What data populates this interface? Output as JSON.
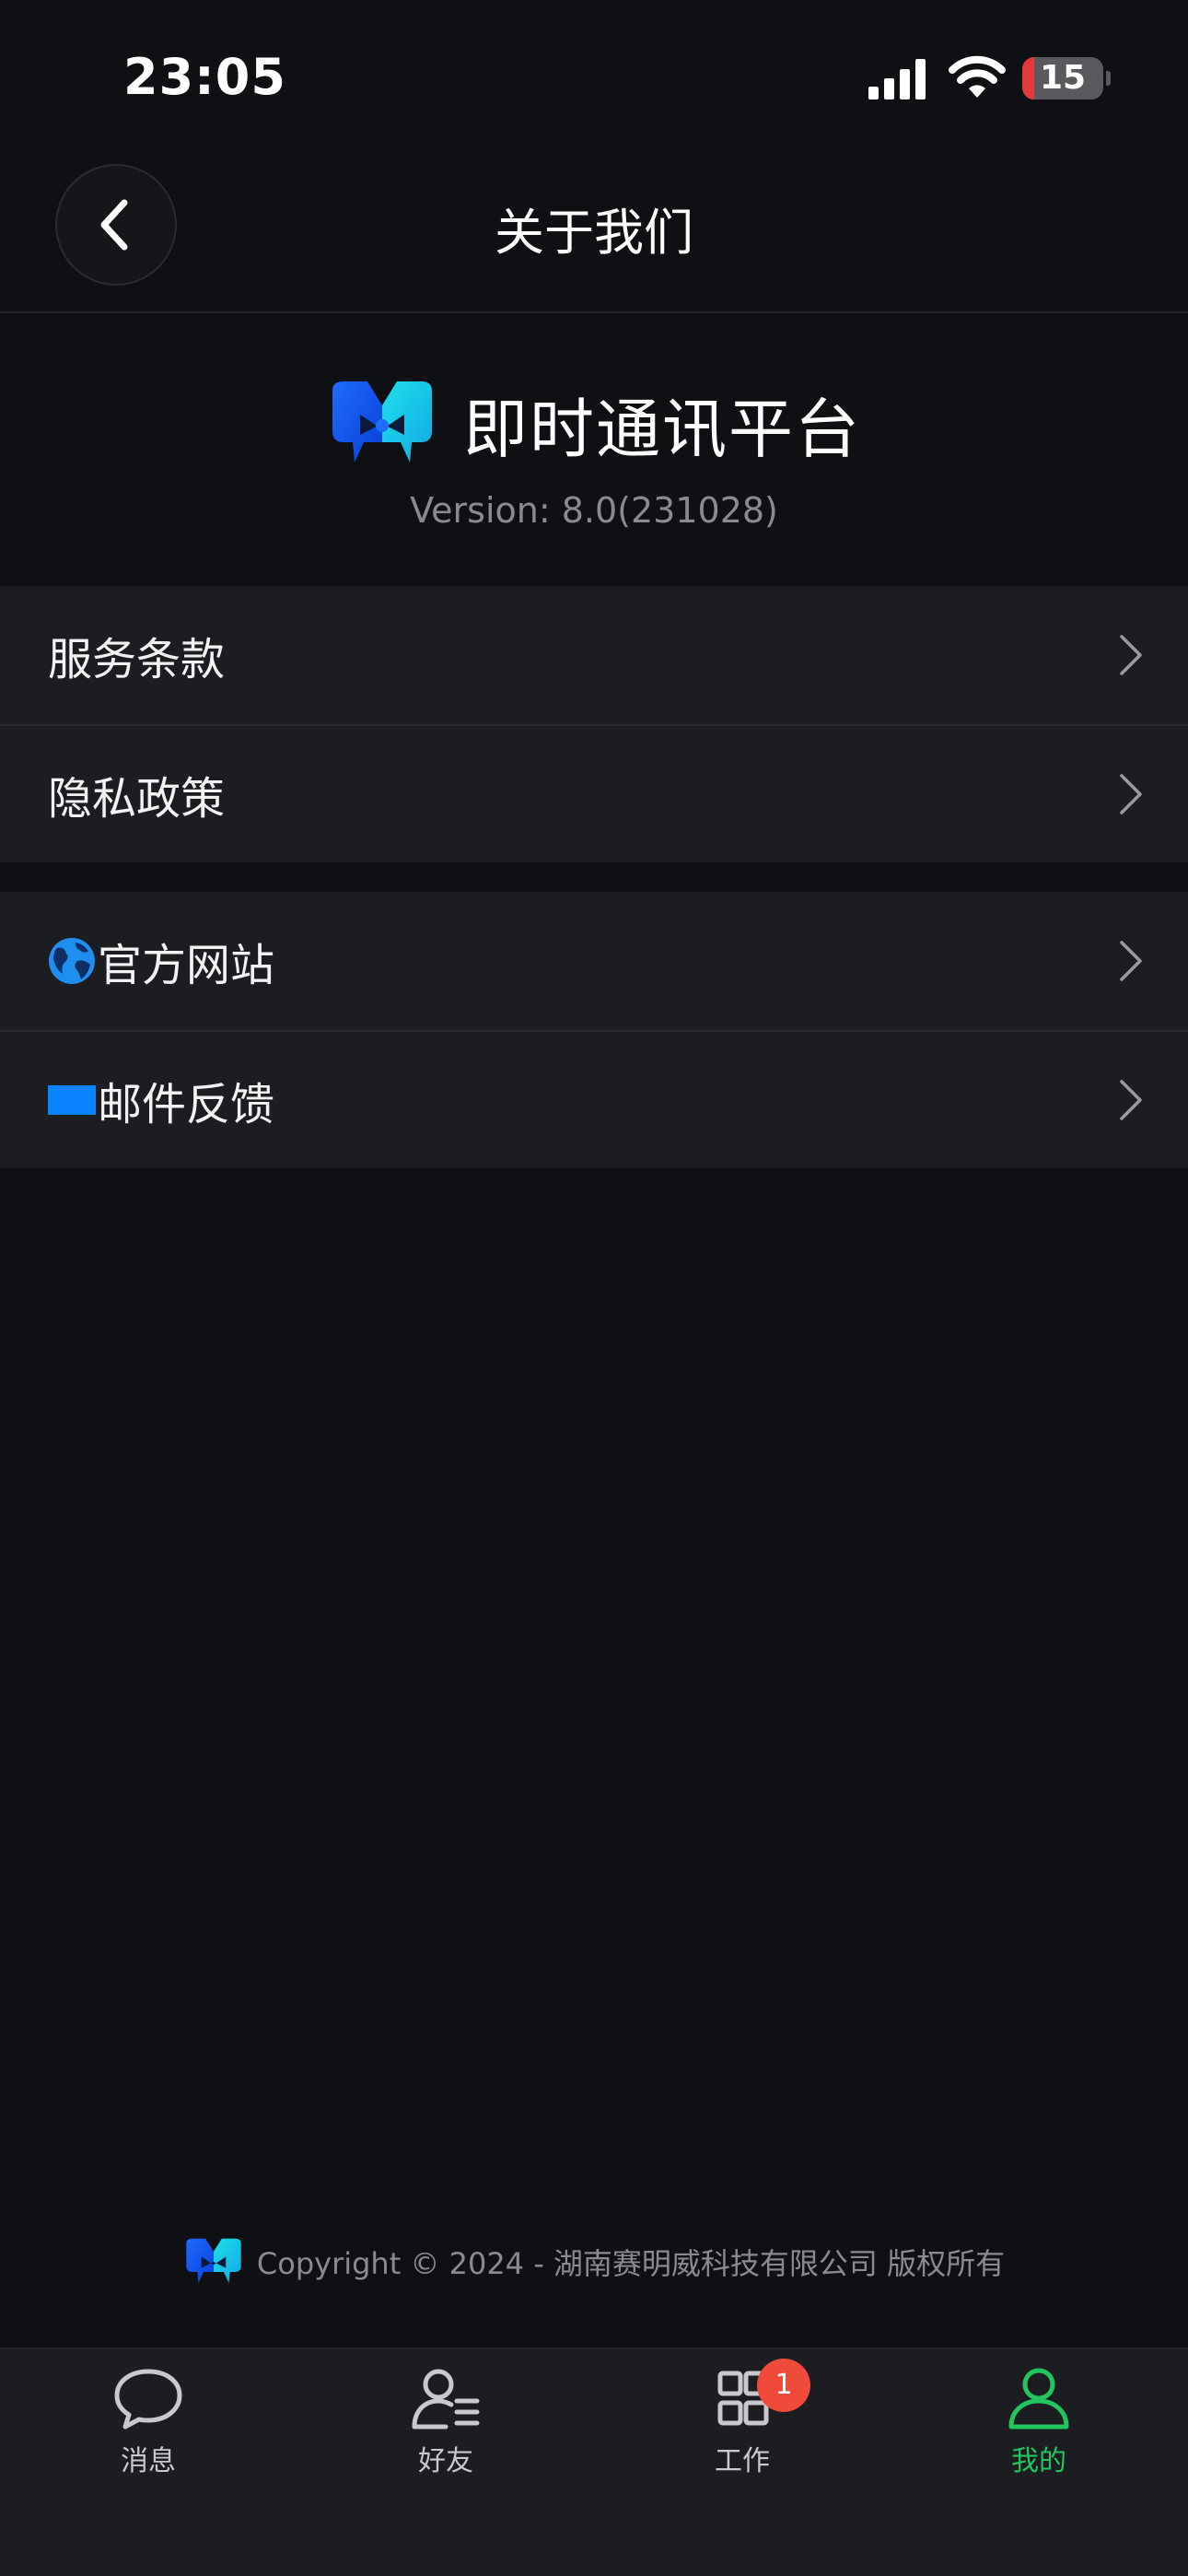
{
  "status_bar": {
    "time": "23:05",
    "battery_level": "15",
    "battery_fraction": 0.15
  },
  "header": {
    "title": "关于我们",
    "back_icon": "chevron-left-icon"
  },
  "brand": {
    "app_name": "即时通讯平台",
    "version": "Version: 8.0(231028)"
  },
  "menu": {
    "group1": [
      {
        "label": "服务条款",
        "icon": "chevron-right-icon"
      },
      {
        "label": "隐私政策",
        "icon": "chevron-right-icon"
      }
    ],
    "group2": [
      {
        "label": "官方网站",
        "leading_icon": "globe-icon"
      },
      {
        "label": "邮件反馈",
        "leading_icon": "blue-rectangle-icon"
      }
    ]
  },
  "footer": {
    "copyright": "Copyright © 2024 - 湖南赛明威科技有限公司 版权所有"
  },
  "tab_bar": {
    "tabs": [
      {
        "label": "消息",
        "icon": "chat-bubble-icon"
      },
      {
        "label": "好友",
        "icon": "contacts-icon"
      },
      {
        "label": "工作",
        "icon": "grid-icon",
        "badge": "1"
      },
      {
        "label": "我的",
        "icon": "person-icon",
        "active": true
      }
    ]
  },
  "colors": {
    "accent": "#22c55e",
    "background": "#0f1014",
    "card": "#1c1d21",
    "badge": "#f04b3a",
    "battery_low": "#e5383b"
  }
}
